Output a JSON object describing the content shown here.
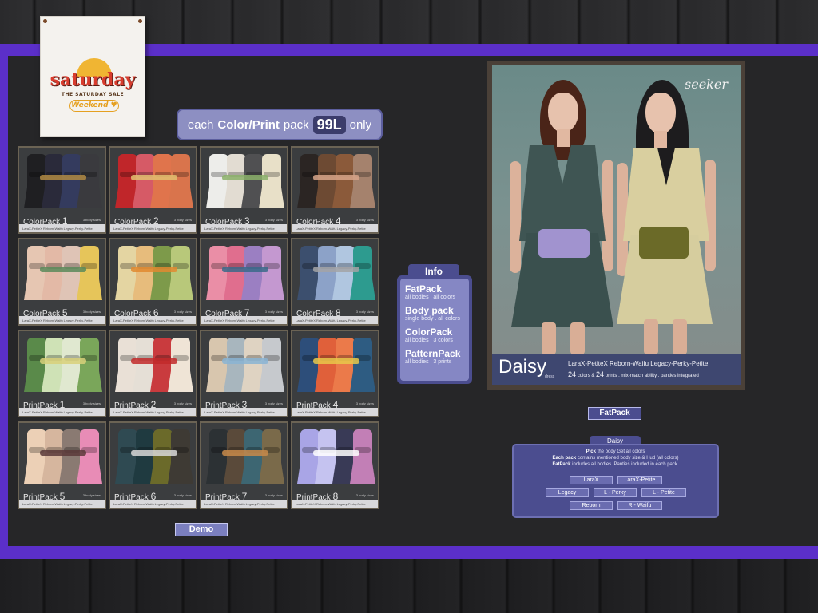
{
  "sale_poster": {
    "title": "saturday",
    "subtitle": "THE SATURDAY SALE",
    "badge": "Weekend ♥"
  },
  "price_banner": {
    "prefix": "each",
    "bold": "Color/Print",
    "middle": "pack",
    "price": "99L",
    "suffix": "only"
  },
  "tiles": [
    {
      "name": "ColorPack",
      "num": "1",
      "colors": [
        "#1f1f22",
        "#2a2a3a",
        "#343b5e",
        "#3a3a3e"
      ],
      "bow": "#b08a43"
    },
    {
      "name": "ColorPack",
      "num": "2",
      "colors": [
        "#c0262a",
        "#d65a66",
        "#e0744c",
        "#d9744c"
      ],
      "bow": "#e0c070"
    },
    {
      "name": "ColorPack",
      "num": "3",
      "colors": [
        "#ededea",
        "#e2dcd2",
        "#505052",
        "#e8e0c8"
      ],
      "bow": "#8bb06a"
    },
    {
      "name": "ColorPack",
      "num": "4",
      "colors": [
        "#2b2523",
        "#6d4a33",
        "#8b5a3a",
        "#a5826d"
      ],
      "bow": "#d7a58a"
    },
    {
      "name": "ColorPack",
      "num": "5",
      "colors": [
        "#e6c6b2",
        "#e3b9a6",
        "#dfc4b6",
        "#e6c55a"
      ],
      "bow": "#5a8a5a"
    },
    {
      "name": "ColorPack",
      "num": "6",
      "colors": [
        "#e4d5a2",
        "#e7bc7c",
        "#7d9a4a",
        "#b8c87a"
      ],
      "bow": "#e08a30"
    },
    {
      "name": "ColorPack",
      "num": "7",
      "colors": [
        "#ea8ea6",
        "#e06e8e",
        "#9b7fc2",
        "#c498d0"
      ],
      "bow": "#3a6a8a"
    },
    {
      "name": "ColorPack",
      "num": "8",
      "colors": [
        "#3c4f6e",
        "#8ca2c8",
        "#b0c6e0",
        "#2d9b8f"
      ],
      "bow": "#a3a3a6"
    },
    {
      "name": "PrintPack",
      "num": "1",
      "colors": [
        "#5a8a4a",
        "#cfe2b6",
        "#e0e8d0",
        "#7aa65a"
      ],
      "bow": "#d8d07a"
    },
    {
      "name": "PrintPack",
      "num": "2",
      "colors": [
        "#e9e0d6",
        "#e5dfd6",
        "#c93b3e",
        "#efe4d6"
      ],
      "bow": "#c22a2a"
    },
    {
      "name": "PrintPack",
      "num": "3",
      "colors": [
        "#d8c6ae",
        "#a8b6be",
        "#dfd3c2",
        "#c6c9cd"
      ],
      "bow": "#8ab4d4"
    },
    {
      "name": "PrintPack",
      "num": "4",
      "colors": [
        "#2d4e7a",
        "#e0603a",
        "#eb7a4a",
        "#2e5c82"
      ],
      "bow": "#e8c84a"
    },
    {
      "name": "PrintPack",
      "num": "5",
      "colors": [
        "#ecd0b6",
        "#d6b69e",
        "#8a7a72",
        "#e88cb6"
      ],
      "bow": "#5a3a3a"
    },
    {
      "name": "PrintPack",
      "num": "6",
      "colors": [
        "#2f4a52",
        "#1f3a40",
        "#6b6a2a",
        "#3e3a34"
      ],
      "bow": "#d8d8d8"
    },
    {
      "name": "PrintPack",
      "num": "7",
      "colors": [
        "#2c3134",
        "#5a4a3a",
        "#3d6672",
        "#7a6a4a"
      ],
      "bow": "#c88a4a"
    },
    {
      "name": "PrintPack",
      "num": "8",
      "colors": [
        "#a9a5e6",
        "#c5c3f0",
        "#393a56",
        "#c27fb6"
      ],
      "bow": "#ffffff"
    }
  ],
  "tile_strip_text": "LaraX-PetiteX   Reborn-Waifu   Legacy-Perky-Petite",
  "tile_badge_text": "3 body sizes",
  "demo_button": "Demo",
  "info": {
    "title": "Info",
    "items": [
      {
        "heading": "FatPack",
        "sub": "all bodies . all colors"
      },
      {
        "heading": "Body pack",
        "sub": "single body . all colors"
      },
      {
        "heading": "ColorPack",
        "sub": "all bodies . 3 colors"
      },
      {
        "heading": "PatternPack",
        "sub": "all bodies . 3 prints"
      }
    ]
  },
  "ad": {
    "brand": "seeker",
    "product": "Daisy",
    "product_sub": "dress",
    "bodies": "LaraX-PetiteX   Reborn-Waifu   Legacy-Perky-Petite",
    "desc_colors_num": "24",
    "desc_colors_text": "colors &",
    "desc_prints_num": "24",
    "desc_rest": "prints . mix-match ability . panties integrated"
  },
  "fatpack_button": "FatPack",
  "hud": {
    "title": "Daisy",
    "line1_bold": "Pick",
    "line1": "the body Get all colors",
    "line2_bold": "Each pack",
    "line2": "contains mentioned body size & Hud (all colors)",
    "line3_bold": "FatPack",
    "line3": "includes all bodies. Panties included in each pack.",
    "buttons": [
      "LaraX",
      "LaraX-Petite",
      "Legacy",
      "L - Perky",
      "L - Petite",
      "Reborn",
      "R - Waifu"
    ]
  },
  "colors": {
    "board_frame": "#5b2fc9",
    "panel": "#4b4d8f",
    "panel_light": "#8587c4"
  }
}
